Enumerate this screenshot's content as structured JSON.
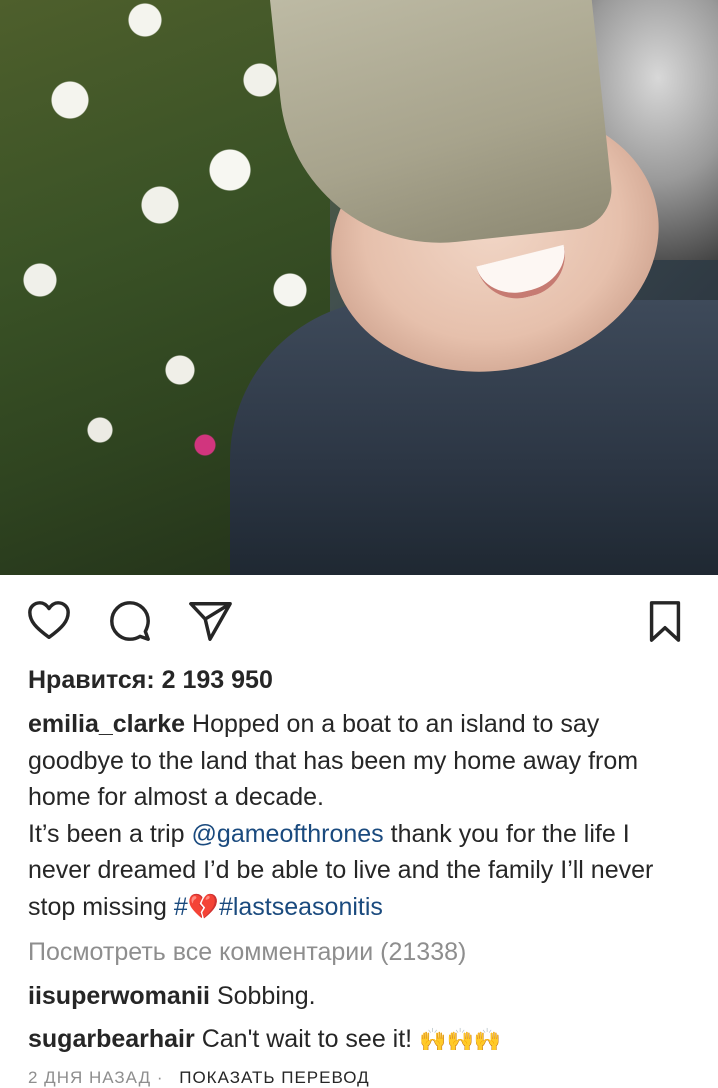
{
  "post": {
    "likes_text": "Нравится: 2 193 950",
    "author": "emilia_clarke",
    "caption_parts": {
      "p1": "Hopped on a boat to an island to say goodbye to the land that has been my home away from home for almost a decade.",
      "p2_prefix": "It’s been a trip ",
      "mention": "@gameofthrones",
      "p2_suffix": " thank you for the life I never dreamed I’d be able to live and the family I’ll never stop missing ",
      "hashtag_1": "#💔",
      "hashtag_2": "#lastseasonitis"
    },
    "view_all_comments": "Посмотреть все комментарии (21338)",
    "comments": [
      {
        "user": "iisuperwomanii",
        "text": "Sobbing."
      },
      {
        "user": "sugarbearhair",
        "text": "Can't wait to see it!",
        "emoji": "🙌🙌🙌"
      }
    ],
    "footer": {
      "time": "2 ДНЯ НАЗАД",
      "separator": "·",
      "translate": "ПОКАЗАТЬ ПЕРЕВОД"
    }
  },
  "icons": {
    "like": "heart-icon",
    "comment": "comment-bubble-icon",
    "share": "paper-plane-icon",
    "save": "bookmark-icon"
  },
  "colors": {
    "text": "#262626",
    "link": "#1a4a7e",
    "muted": "#8e8e8e"
  }
}
